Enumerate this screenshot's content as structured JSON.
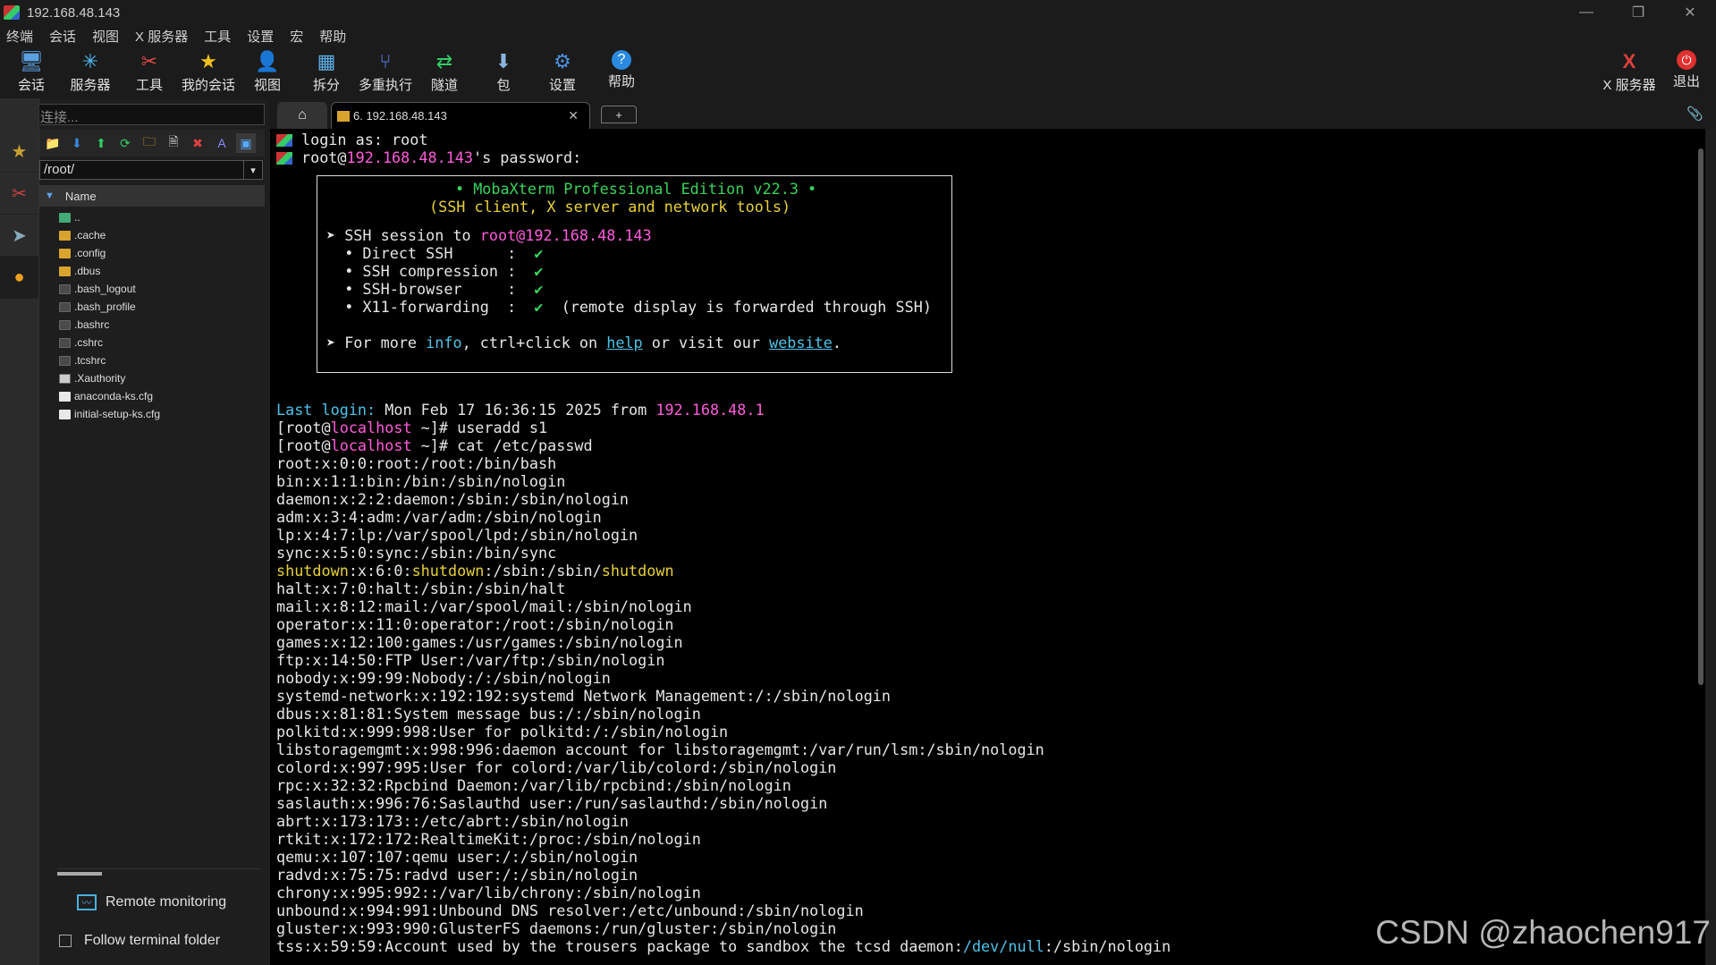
{
  "window": {
    "title": "192.168.48.143"
  },
  "menu": [
    "终端",
    "会话",
    "视图",
    "X 服务器",
    "工具",
    "设置",
    "宏",
    "帮助"
  ],
  "toolbar": [
    {
      "label": "会话",
      "icon": "session-icon"
    },
    {
      "label": "服务器",
      "icon": "servers-icon"
    },
    {
      "label": "工具",
      "icon": "tools-icon"
    },
    {
      "label": "我的会话",
      "icon": "star-icon"
    },
    {
      "label": "视图",
      "icon": "view-icon"
    },
    {
      "label": "拆分",
      "icon": "split-icon"
    },
    {
      "label": "多重执行",
      "icon": "multiexec-icon"
    },
    {
      "label": "隧道",
      "icon": "tunnel-icon"
    },
    {
      "label": "包",
      "icon": "packages-icon"
    },
    {
      "label": "设置",
      "icon": "settings-icon"
    },
    {
      "label": "帮助",
      "icon": "help-icon"
    }
  ],
  "toolbar_right": [
    {
      "label": "X 服务器",
      "icon": "x-server-icon"
    },
    {
      "label": "退出",
      "icon": "power-icon"
    }
  ],
  "quick_connect_placeholder": "快速连接...",
  "sftp": {
    "path": "/root/",
    "column": "Name",
    "files": [
      {
        "name": "..",
        "type": "up"
      },
      {
        "name": ".cache",
        "type": "folder"
      },
      {
        "name": ".config",
        "type": "folder"
      },
      {
        "name": ".dbus",
        "type": "folder"
      },
      {
        "name": ".bash_logout",
        "type": "file"
      },
      {
        "name": ".bash_profile",
        "type": "file"
      },
      {
        "name": ".bashrc",
        "type": "file"
      },
      {
        "name": ".cshrc",
        "type": "file"
      },
      {
        "name": ".tcshrc",
        "type": "file"
      },
      {
        "name": ".Xauthority",
        "type": "file"
      },
      {
        "name": "anaconda-ks.cfg",
        "type": "cfg"
      },
      {
        "name": "initial-setup-ks.cfg",
        "type": "cfg"
      }
    ],
    "remote_monitoring": "Remote monitoring",
    "follow_terminal": "Follow terminal folder"
  },
  "tabs": {
    "session_tab": "6. 192.168.48.143",
    "new_tab": "+"
  },
  "terminal": {
    "login": "login as: root",
    "pw_user": "root@",
    "pw_host": "192.168.48.143",
    "pw_rest": "'s password:",
    "banner": {
      "line1": "• MobaXterm Professional Edition v22.3 •",
      "line2": "(SSH client, X server and network tools)",
      "ssh_session": "➤ SSH session to ",
      "ssh_target": "root@192.168.48.143",
      "features": [
        {
          "label": "  • Direct SSH      :  ",
          "mark": "✔",
          "note": ""
        },
        {
          "label": "  • SSH compression :  ",
          "mark": "✔",
          "note": ""
        },
        {
          "label": "  • SSH-browser     :  ",
          "mark": "✔",
          "note": ""
        },
        {
          "label": "  • X11-forwarding  :  ",
          "mark": "✔",
          "note": "  (remote display is forwarded through SSH)"
        }
      ],
      "more_pre": "➤ For more ",
      "more_info": "info",
      "more_mid": ", ctrl+click on ",
      "more_help": "help",
      "more_mid2": " or visit our ",
      "more_site": "website",
      "more_end": "."
    },
    "last_login_label": "Last login:",
    "last_login_text": " Mon Feb 17 16:36:15 2025 from ",
    "last_login_ip": "192.168.48.1",
    "prompt_open": "[root@",
    "prompt_host": "localhost",
    "prompt_close": " ~]# ",
    "cmd1": "useradd s1",
    "cmd2": "cat /etc/passwd",
    "passwd_lines": [
      "root:x:0:0:root:/root:/bin/bash",
      "bin:x:1:1:bin:/bin:/sbin/nologin",
      "daemon:x:2:2:daemon:/sbin:/sbin/nologin",
      "adm:x:3:4:adm:/var/adm:/sbin/nologin",
      "lp:x:4:7:lp:/var/spool/lpd:/sbin/nologin",
      "sync:x:5:0:sync:/sbin:/bin/sync",
      "",
      "halt:x:7:0:halt:/sbin:/sbin/halt",
      "mail:x:8:12:mail:/var/spool/mail:/sbin/nologin",
      "operator:x:11:0:operator:/root:/sbin/nologin",
      "games:x:12:100:games:/usr/games:/sbin/nologin",
      "ftp:x:14:50:FTP User:/var/ftp:/sbin/nologin",
      "nobody:x:99:99:Nobody:/:/sbin/nologin",
      "systemd-network:x:192:192:systemd Network Management:/:/sbin/nologin",
      "dbus:x:81:81:System message bus:/:/sbin/nologin",
      "polkitd:x:999:998:User for polkitd:/:/sbin/nologin",
      "libstoragemgmt:x:998:996:daemon account for libstoragemgmt:/var/run/lsm:/sbin/nologin",
      "colord:x:997:995:User for colord:/var/lib/colord:/sbin/nologin",
      "rpc:x:32:32:Rpcbind Daemon:/var/lib/rpcbind:/sbin/nologin",
      "saslauth:x:996:76:Saslauthd user:/run/saslauthd:/sbin/nologin",
      "abrt:x:173:173::/etc/abrt:/sbin/nologin",
      "rtkit:x:172:172:RealtimeKit:/proc:/sbin/nologin",
      "qemu:x:107:107:qemu user:/:/sbin/nologin",
      "radvd:x:75:75:radvd user:/:/sbin/nologin",
      "chrony:x:995:992::/var/lib/chrony:/sbin/nologin",
      "unbound:x:994:991:Unbound DNS resolver:/etc/unbound:/sbin/nologin",
      "gluster:x:993:990:GlusterFS daemons:/run/gluster:/sbin/nologin"
    ],
    "shutdown_parts": [
      "shutdown",
      ":x:6:0:",
      "shutdown",
      ":/sbin:/sbin/",
      "shutdown"
    ],
    "tss_pre": "tss:x:59:59:Account used by the trousers package to sandbox the tcsd daemon:",
    "tss_dev": "/dev/null",
    "tss_post": ":/sbin/nologin"
  },
  "watermark": "CSDN @zhaochen917",
  "colors": {
    "magenta": "#ff5cdb",
    "cyan": "#4fc3e8",
    "green": "#39d45a",
    "yellow": "#e8d038"
  }
}
